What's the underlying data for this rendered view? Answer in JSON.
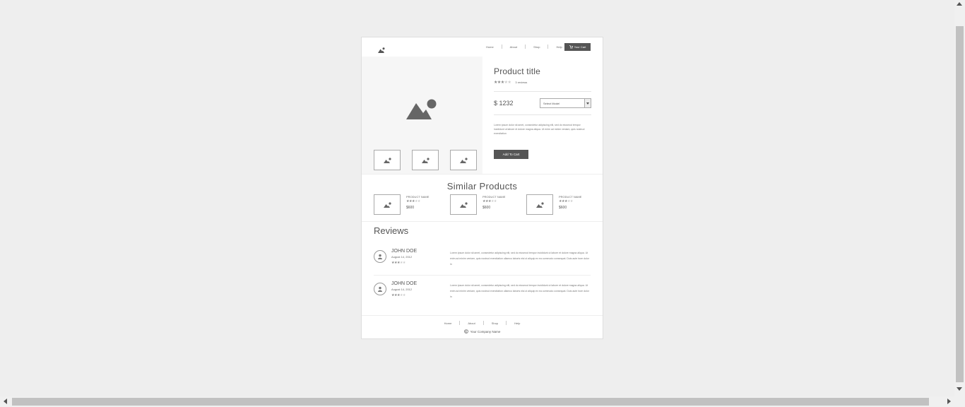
{
  "header": {
    "nav": [
      {
        "label": "Home"
      },
      {
        "label": "About"
      },
      {
        "label": "Shop"
      },
      {
        "label": "Help"
      }
    ],
    "cart_label": "Your Cart"
  },
  "product": {
    "title": "Product title",
    "rating": 3,
    "reviews_count": "3 reviews",
    "price": "$ 1232",
    "select_placeholder": "Select Model",
    "description": "Lorem ipsum dolor sit amet, consectetur adipiscing elit, sed do eiusmod tempor incididunt ut labore et dolore magna aliqua. Ut enim ad minim veniam, quis nostrud exercitation",
    "add_to_cart": "Add To Cart"
  },
  "similar": {
    "title": "Similar Products",
    "items": [
      {
        "name": "PRODUCT NAME",
        "rating": 3,
        "price": "$600"
      },
      {
        "name": "PRODUCT NAME",
        "rating": 3,
        "price": "$600"
      },
      {
        "name": "PRODUCT NAME",
        "rating": 3,
        "price": "$600"
      }
    ]
  },
  "reviews": {
    "title": "Reviews",
    "items": [
      {
        "name": "JOHN DOE",
        "date": "August 14, 2012",
        "rating": 3,
        "text": "Lorem ipsum dolor sit amet, consectetur adipiscing elit, sed do eiusmod tempor incididunt ut labore et dolore magna aliqua. Ut enim ad minim veniam, quis nostrud exercitation ullamco laboris nisi ut aliquip ex ea commodo consequat. Duis aute irure dolor in"
      },
      {
        "name": "JOHN DOE",
        "date": "August 14, 2012",
        "rating": 3,
        "text": "Lorem ipsum dolor sit amet, consectetur adipiscing elit, sed do eiusmod tempor incididunt ut labore et dolore magna aliqua. Ut enim ad minim veniam, quis nostrud exercitation ullamco laboris nisi ut aliquip ex ea commodo consequat. Duis aute irure dolor in"
      }
    ]
  },
  "footer": {
    "nav": [
      {
        "label": "Home"
      },
      {
        "label": "About"
      },
      {
        "label": "Shop"
      },
      {
        "label": "Help"
      }
    ],
    "copyright": "Your Company Name"
  },
  "icons": {
    "logo": "image-icon",
    "cart": "cart-icon",
    "avatar": "user-icon",
    "copyright": "copyright-icon"
  },
  "colors": {
    "accent": "#555555",
    "page_bg": "#eeeeee",
    "card_bg": "#ffffff"
  }
}
